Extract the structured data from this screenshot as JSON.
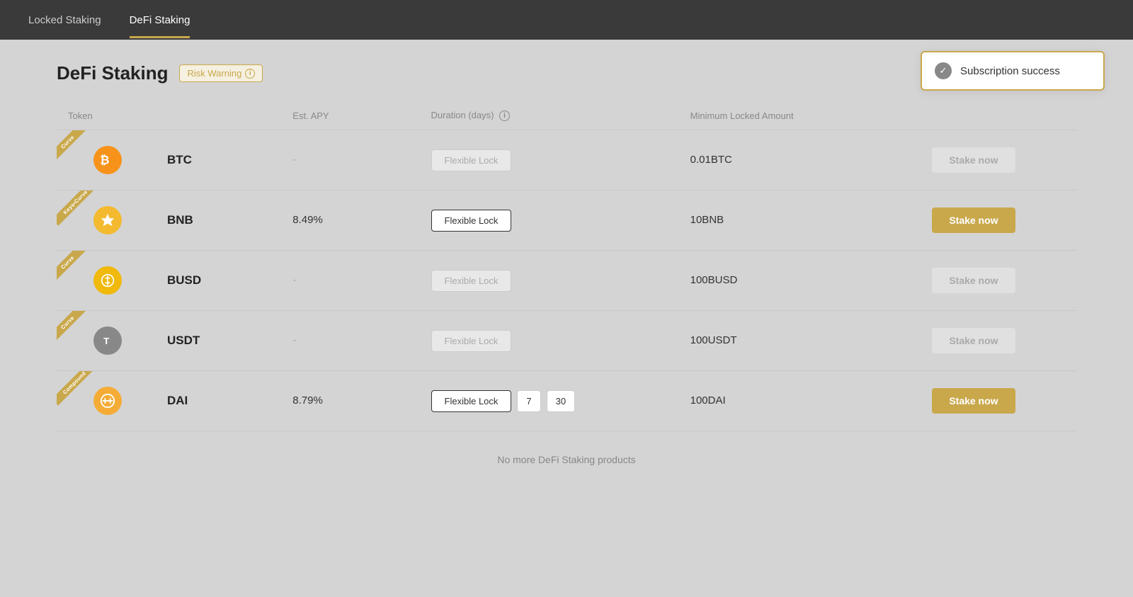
{
  "nav": {
    "tabs": [
      {
        "id": "locked",
        "label": "Locked Staking",
        "active": false
      },
      {
        "id": "defi",
        "label": "DeFi Staking",
        "active": true
      }
    ]
  },
  "page": {
    "title": "DeFi Staking",
    "risk_warning_label": "Risk Warning"
  },
  "table": {
    "headers": {
      "token": "Token",
      "est_apy": "Est. APY",
      "duration": "Duration (days)",
      "min_locked": "Minimum Locked Amount"
    },
    "rows": [
      {
        "id": "btc",
        "badge": "Curve",
        "symbol": "BTC",
        "icon_symbol": "₿",
        "icon_class": "btc",
        "apy": "-",
        "apy_active": false,
        "duration_flexible": true,
        "duration_numbers": [],
        "duration_active": false,
        "min_amount": "0.01BTC",
        "stake_active": false,
        "stake_label": "Stake now"
      },
      {
        "id": "bnb",
        "badge": "Keys•Curve",
        "symbol": "BNB",
        "icon_symbol": "◈",
        "icon_class": "bnb",
        "apy": "8.49%",
        "apy_active": true,
        "duration_flexible": true,
        "duration_numbers": [],
        "duration_active": true,
        "min_amount": "10BNB",
        "stake_active": true,
        "stake_label": "Stake now"
      },
      {
        "id": "busd",
        "badge": "Curve",
        "symbol": "BUSD",
        "icon_symbol": "⊛",
        "icon_class": "busd",
        "apy": "-",
        "apy_active": false,
        "duration_flexible": true,
        "duration_numbers": [],
        "duration_active": false,
        "min_amount": "100BUSD",
        "stake_active": false,
        "stake_label": "Stake now"
      },
      {
        "id": "usdt",
        "badge": "Curve",
        "symbol": "USDT",
        "icon_symbol": "T",
        "icon_class": "usdt",
        "apy": "-",
        "apy_active": false,
        "duration_flexible": true,
        "duration_numbers": [],
        "duration_active": false,
        "min_amount": "100USDT",
        "stake_active": false,
        "stake_label": "Stake now"
      },
      {
        "id": "dai",
        "badge": "Compound",
        "symbol": "DAI",
        "icon_symbol": "⊜",
        "icon_class": "dai",
        "apy": "8.79%",
        "apy_active": true,
        "duration_flexible": true,
        "duration_numbers": [
          "7",
          "30"
        ],
        "duration_active": true,
        "min_amount": "100DAI",
        "stake_active": true,
        "stake_label": "Stake now"
      }
    ],
    "footer": "No more DeFi Staking products"
  },
  "toast": {
    "message": "Subscription success"
  }
}
